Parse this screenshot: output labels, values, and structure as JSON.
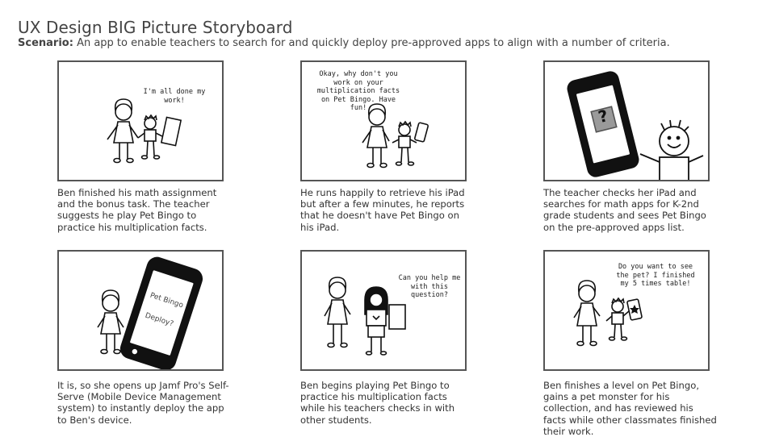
{
  "header": {
    "title": "UX Design BIG Picture Storyboard",
    "scenario_label": "Scenario:",
    "scenario_text": "An app to enable teachers to search for and quickly deploy pre-approved apps to align with a number of criteria."
  },
  "panels": [
    {
      "bubble": "I'm all done my work!",
      "caption": "Ben finished his math assignment and the bonus task. The teacher suggests he play Pet Bingo to practice his multiplication facts."
    },
    {
      "bubble": "Okay, why don't you work on your multiplication facts on Pet Bingo. Have fun!",
      "caption": "He runs happily to retrieve his iPad but after a few minutes, he reports that he doesn't have Pet Bingo on his iPad."
    },
    {
      "bubble": "?",
      "caption": "The teacher checks her iPad and searches for math apps for K-2nd grade students and sees Pet Bingo on the pre-approved apps list."
    },
    {
      "phone_line1": "Pet Bingo",
      "phone_line2": "Deploy?",
      "caption": "It is, so she opens up Jamf Pro's Self-Serve (Mobile Device Management system) to instantly deploy the app to Ben's device."
    },
    {
      "bubble": "Can you help me with this question?",
      "caption": "Ben begins playing Pet Bingo to practice his multiplication facts while his teachers checks in with other students."
    },
    {
      "bubble": "Do you want to see the pet? I finished my 5 times table!",
      "caption": "Ben finishes a level on Pet Bingo, gains a pet monster for his collection, and has reviewed his facts while other classmates finished their work."
    }
  ]
}
